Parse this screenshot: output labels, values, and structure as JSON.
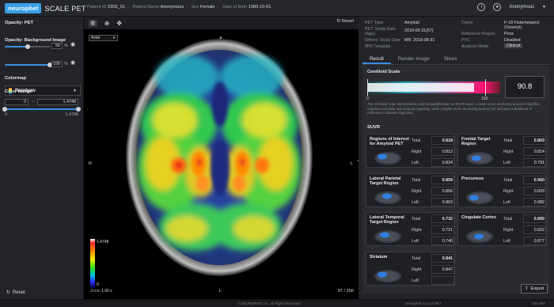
{
  "app": {
    "brand": "neurophet",
    "product": "SCALE PET"
  },
  "patient": {
    "id_label": "Patient ID",
    "id": "2302_01",
    "name_label": "Patient Name",
    "name": "Anonymous",
    "sex_label": "Sex",
    "sex": "Female",
    "dob_label": "Date of Birth",
    "dob": "1960-10-01"
  },
  "user": {
    "name": "Anonymous",
    "help_icon": "info-icon"
  },
  "left": {
    "opacity_pet": {
      "label": "Opacity: PET",
      "value": "50",
      "unit": "%",
      "fraction": 0.5
    },
    "opacity_bg": {
      "label": "Opacity: Background Image",
      "value": "100",
      "unit": "%",
      "fraction": 1.0
    },
    "colormap": {
      "label": "Colormap",
      "value": "Rainbow"
    },
    "color_range": {
      "label": "Color Range",
      "min": "0",
      "max": "1.4748",
      "min_label": "0",
      "max_label": "1.4748"
    },
    "reset_label": "Reset"
  },
  "viewer": {
    "reset_label": "Reset",
    "view_select": "Axial",
    "orient": {
      "top": "A",
      "bottom": "L",
      "left": "R",
      "right": "L"
    },
    "colorbar_max": "1.4748",
    "colorbar_min": "0",
    "zoom_label": "Zoom",
    "zoom_value": "1.00 x",
    "slice": "97 / 256"
  },
  "meta": {
    "pet_type_label": "PET Type",
    "pet_type": "Amyloid",
    "pet_date_label": "PET: Study Date (Age)",
    "pet_date": "2018-08-31(57)",
    "other_date_label": "Others: Study Date",
    "other_date": "MR: 2018-08-31",
    "mni_label": "MNI Template",
    "mni": "-",
    "tracer_label": "Tracer",
    "tracer": "F-18 Flutemetamol (Vizamyl)",
    "ref_label": "Reference Region",
    "ref": "Pons",
    "pvc_label": "PVC",
    "pvc": "Disabled",
    "mode_label": "Analysis Mode",
    "mode": "Clinical"
  },
  "tabs": [
    {
      "label": "Result",
      "active": true
    },
    {
      "label": "Render Image",
      "active": false
    },
    {
      "label": "Slices",
      "active": false
    }
  ],
  "centiloid": {
    "title": "Centiloid Scale",
    "value": "90.8",
    "tick_min": "0",
    "tick_max": "100",
    "note": "The Centiloid scale standardizes amyloid quantification as SUVR basis. A lower score anchoring around 0 signifies cognitive normality and amyloid negativity, while a higher score anchoring around 100 indicates a likelihood of Alzheimer's disease diagnosis."
  },
  "suvr": {
    "title": "SUVR",
    "row_labels": {
      "total": "Total",
      "right": "Right",
      "left": "Left"
    },
    "regions": [
      {
        "name": "Regions of Interest for Amyloid PET",
        "total": "0.818",
        "right": "0.812",
        "left": "0.824"
      },
      {
        "name": "Frontal Target Region",
        "total": "0.803",
        "right": "0.814",
        "left": "0.791"
      },
      {
        "name": "Lateral Parietal Target Region",
        "total": "0.859",
        "right": "0.856",
        "left": "0.863"
      },
      {
        "name": "Precuneus",
        "total": "0.960",
        "right": "0.933",
        "left": "0.982"
      },
      {
        "name": "Lateral Temporal Target Region",
        "total": "0.732",
        "right": "0.721",
        "left": "0.740"
      },
      {
        "name": "Cingulate Cortex",
        "total": "0.899",
        "right": "0.922",
        "left": "0.877"
      },
      {
        "name": "Striatum",
        "total": "0.841",
        "right": "0.847",
        "left": ""
      }
    ]
  },
  "export_label": "Export",
  "footer": {
    "copyright": "© NEUROPHET Inc. All Rights Reserved",
    "product": "Neurophet SCALE PET",
    "version": "SW VER."
  },
  "colors": {
    "accent": "#3a8ee0",
    "brand": "#3aa0e6",
    "panel": "#232429"
  }
}
